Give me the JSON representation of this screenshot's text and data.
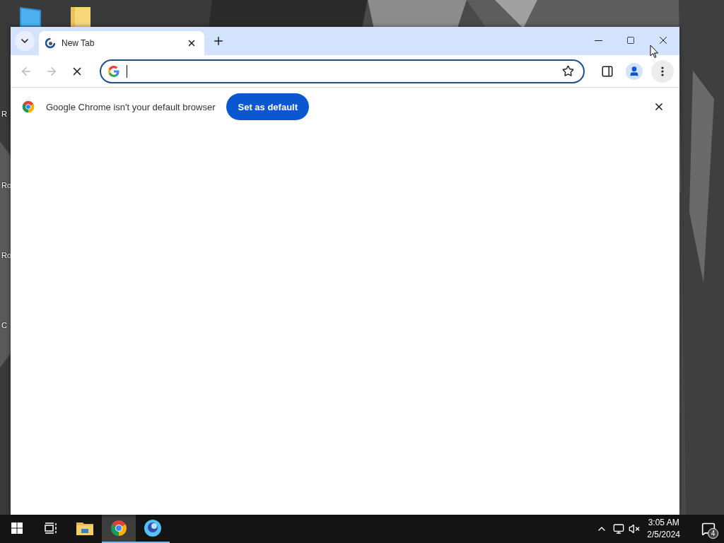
{
  "desktop": {
    "labels": [
      {
        "text": "R"
      },
      {
        "text": "Ro"
      },
      {
        "text": "Ro"
      },
      {
        "text": "C"
      }
    ]
  },
  "tabs": [
    {
      "title": "New Tab",
      "selected": true
    }
  ],
  "navigation": {
    "back_disabled": true,
    "forward_disabled": true,
    "loading": true
  },
  "omnibox": {
    "focused": true
  },
  "infobar": {
    "message": "Google Chrome isn't your default browser",
    "button": "Set as default"
  },
  "taskbar": {
    "apps": [
      {
        "kind": "explorer",
        "selected": false,
        "running": false
      },
      {
        "kind": "chrome",
        "selected": true,
        "running": true
      },
      {
        "kind": "orb",
        "selected": false,
        "running": true
      }
    ],
    "time": "3:05 AM",
    "date": "2/5/2024",
    "notifications": "4"
  }
}
